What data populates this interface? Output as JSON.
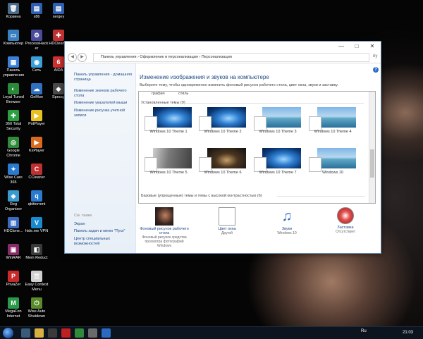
{
  "colors": {
    "link": "#1e4a86",
    "window_border": "#6b8fb5",
    "taskbar": "#0c1420"
  },
  "desktop_icons": [
    {
      "label": "Корзина",
      "icon": "recycle-bin-icon",
      "color": "#4a6a8a",
      "glyph": "🗑"
    },
    {
      "label": "x86",
      "icon": "folder-icon",
      "color": "#2f5fb0",
      "glyph": "▤"
    },
    {
      "label": "sergey",
      "icon": "user-folder-icon",
      "color": "#2f5fb0",
      "glyph": "▤"
    },
    {
      "label": "Компьютер",
      "icon": "computer-icon",
      "color": "#3a7fc0",
      "glyph": "▭"
    },
    {
      "label": "ProcessHacker",
      "icon": "process-hacker-icon",
      "color": "#4b4b9c",
      "glyph": "⚙"
    },
    {
      "label": "HDCleaner",
      "icon": "hdcleaner-icon",
      "color": "#c03030",
      "glyph": "✚"
    },
    {
      "label": "Панель управления",
      "icon": "control-panel-icon",
      "color": "#3c7fd6",
      "glyph": "▦"
    },
    {
      "label": "Сеть",
      "icon": "network-icon",
      "color": "#3aa0d8",
      "glyph": "◉"
    },
    {
      "label": "AIDA",
      "icon": "aida-icon",
      "color": "#d03030",
      "glyph": "6"
    },
    {
      "label": "Loyal Tuned Browser",
      "icon": "browser-icon",
      "color": "#2a8a3a",
      "glyph": "◐"
    },
    {
      "label": "GeMoe",
      "icon": "gemoe-icon",
      "color": "#3070c0",
      "glyph": "☁"
    },
    {
      "label": "Speccy",
      "icon": "speccy-icon",
      "color": "#4a4a4a",
      "glyph": "◆"
    },
    {
      "label": "360 Total Security",
      "icon": "security-icon",
      "color": "#2aa040",
      "glyph": "✚"
    },
    {
      "label": "PotPlayer",
      "icon": "potplayer-icon",
      "color": "#e8c020",
      "glyph": "▶"
    },
    {
      "label": "Google Chrome",
      "icon": "chrome-icon",
      "color": "#2f8a3a",
      "glyph": "◎"
    },
    {
      "label": "KxPlayer",
      "icon": "kxplayer-icon",
      "color": "#d86a20",
      "glyph": "▶"
    },
    {
      "label": "Wise Care 365",
      "icon": "wise-care-icon",
      "color": "#2a7ad0",
      "glyph": "✦"
    },
    {
      "label": "CCleaner",
      "icon": "ccleaner-icon",
      "color": "#c03030",
      "glyph": "C"
    },
    {
      "label": "Reg Organizer",
      "icon": "reg-organizer-icon",
      "color": "#3a9ad0",
      "glyph": "◈"
    },
    {
      "label": "qbittorrent",
      "icon": "qbittorrent-icon",
      "color": "#2a7ad0",
      "glyph": "q"
    },
    {
      "label": "HDClone...",
      "icon": "hdclone-icon",
      "color": "#3a6ac0",
      "glyph": "▥"
    },
    {
      "label": "hide.me VPN",
      "icon": "vpn-icon",
      "color": "#1a8ad0",
      "glyph": "V"
    },
    {
      "label": "WinRAR",
      "icon": "winrar-icon",
      "color": "#8a2a6a",
      "glyph": "▣"
    },
    {
      "label": "Mem Reduct",
      "icon": "mem-reduct-icon",
      "color": "#3a3a3a",
      "glyph": "◧"
    },
    {
      "label": "PrivaZer",
      "icon": "privazer-icon",
      "color": "#c82a2a",
      "glyph": "P"
    },
    {
      "label": "Easy Context Menu",
      "icon": "easy-context-icon",
      "color": "#d0d0d0",
      "glyph": "☰"
    },
    {
      "label": "MegaFon Internet",
      "icon": "megafon-icon",
      "color": "#2a9a4a",
      "glyph": "M"
    },
    {
      "label": "Wise Auto Shutdown",
      "icon": "wise-shutdown-icon",
      "color": "#5a8a2a",
      "glyph": "⏻"
    }
  ],
  "window": {
    "address": "Панель управления  ›  Оформление и персонализация  ›  Персонализация",
    "search_hint": "ёу",
    "help_glyph": "?",
    "controls": {
      "minimize": "—",
      "maximize": "□",
      "close": "✕"
    }
  },
  "sidebar": {
    "links": [
      "Панель управления - домашняя страница",
      "Изменение значков рабочего стола",
      "Изменение указателей мыши",
      "Изменение рисунка учетной записи"
    ],
    "see_also_header": "См. также",
    "see_also": [
      "Экран",
      "Панель задач и меню \"Пуск\"",
      "Центр специальных возможностей"
    ]
  },
  "main": {
    "title": "Изменение изображения и звуков на компьютере",
    "subtitle": "Выберите тему, чтобы одновременно изменить фоновый рисунок рабочего стола, цвет окна, звуки и заставку.",
    "cut_labels": [
      "графич",
      "стиль"
    ],
    "installed_header": "Установленные темы (9)",
    "contrast_header": "Базовые (упрощенные) темы и темы с высокой контрастностью (6)",
    "themes": [
      {
        "label": "Windows 10 Theme 1",
        "style": "win-blue"
      },
      {
        "label": "Windows 10 Theme 2",
        "style": "win-blue"
      },
      {
        "label": "Windows 10 Theme 3",
        "style": "win-beach"
      },
      {
        "label": "Windows 10 Theme 4",
        "style": "win-beach"
      },
      {
        "label": "Windows 10 Theme 5",
        "style": "win-rock"
      },
      {
        "label": "Windows 10 Theme 6",
        "style": "win-dark"
      },
      {
        "label": "Windows 10 Theme 7",
        "style": "win-blue"
      },
      {
        "label": "Windows 10",
        "style": "win-beach"
      }
    ]
  },
  "bottom": {
    "background": {
      "label": "Фоновый рисунок рабочего стола",
      "sub": "Фоновый рисунок средства просмотра фотографий Windows",
      "icon": "desktop-background-icon"
    },
    "color": {
      "label": "Цвет окна",
      "sub": "Другой",
      "icon": "window-color-icon"
    },
    "sounds": {
      "label": "Звуки",
      "sub": "Windows 10",
      "icon": "sounds-icon"
    },
    "screensaver": {
      "label": "Заставка",
      "sub": "Отсутствует",
      "icon": "screensaver-icon"
    }
  },
  "taskbar": {
    "start_icon": "windows-start-icon",
    "items": [
      {
        "icon": "explorer-icon",
        "color": "#3a5a7a"
      },
      {
        "icon": "folder-icon",
        "color": "#d8b040"
      },
      {
        "icon": "media-icon",
        "color": "#3a3a3a"
      },
      {
        "icon": "opera-icon",
        "color": "#c02020"
      },
      {
        "icon": "chrome-icon",
        "color": "#2f8a3a"
      },
      {
        "icon": "files-icon",
        "color": "#6a6a6a"
      },
      {
        "icon": "personalization-icon",
        "color": "#2a6ac0"
      }
    ],
    "lang": "Ru",
    "time": "21:03"
  }
}
